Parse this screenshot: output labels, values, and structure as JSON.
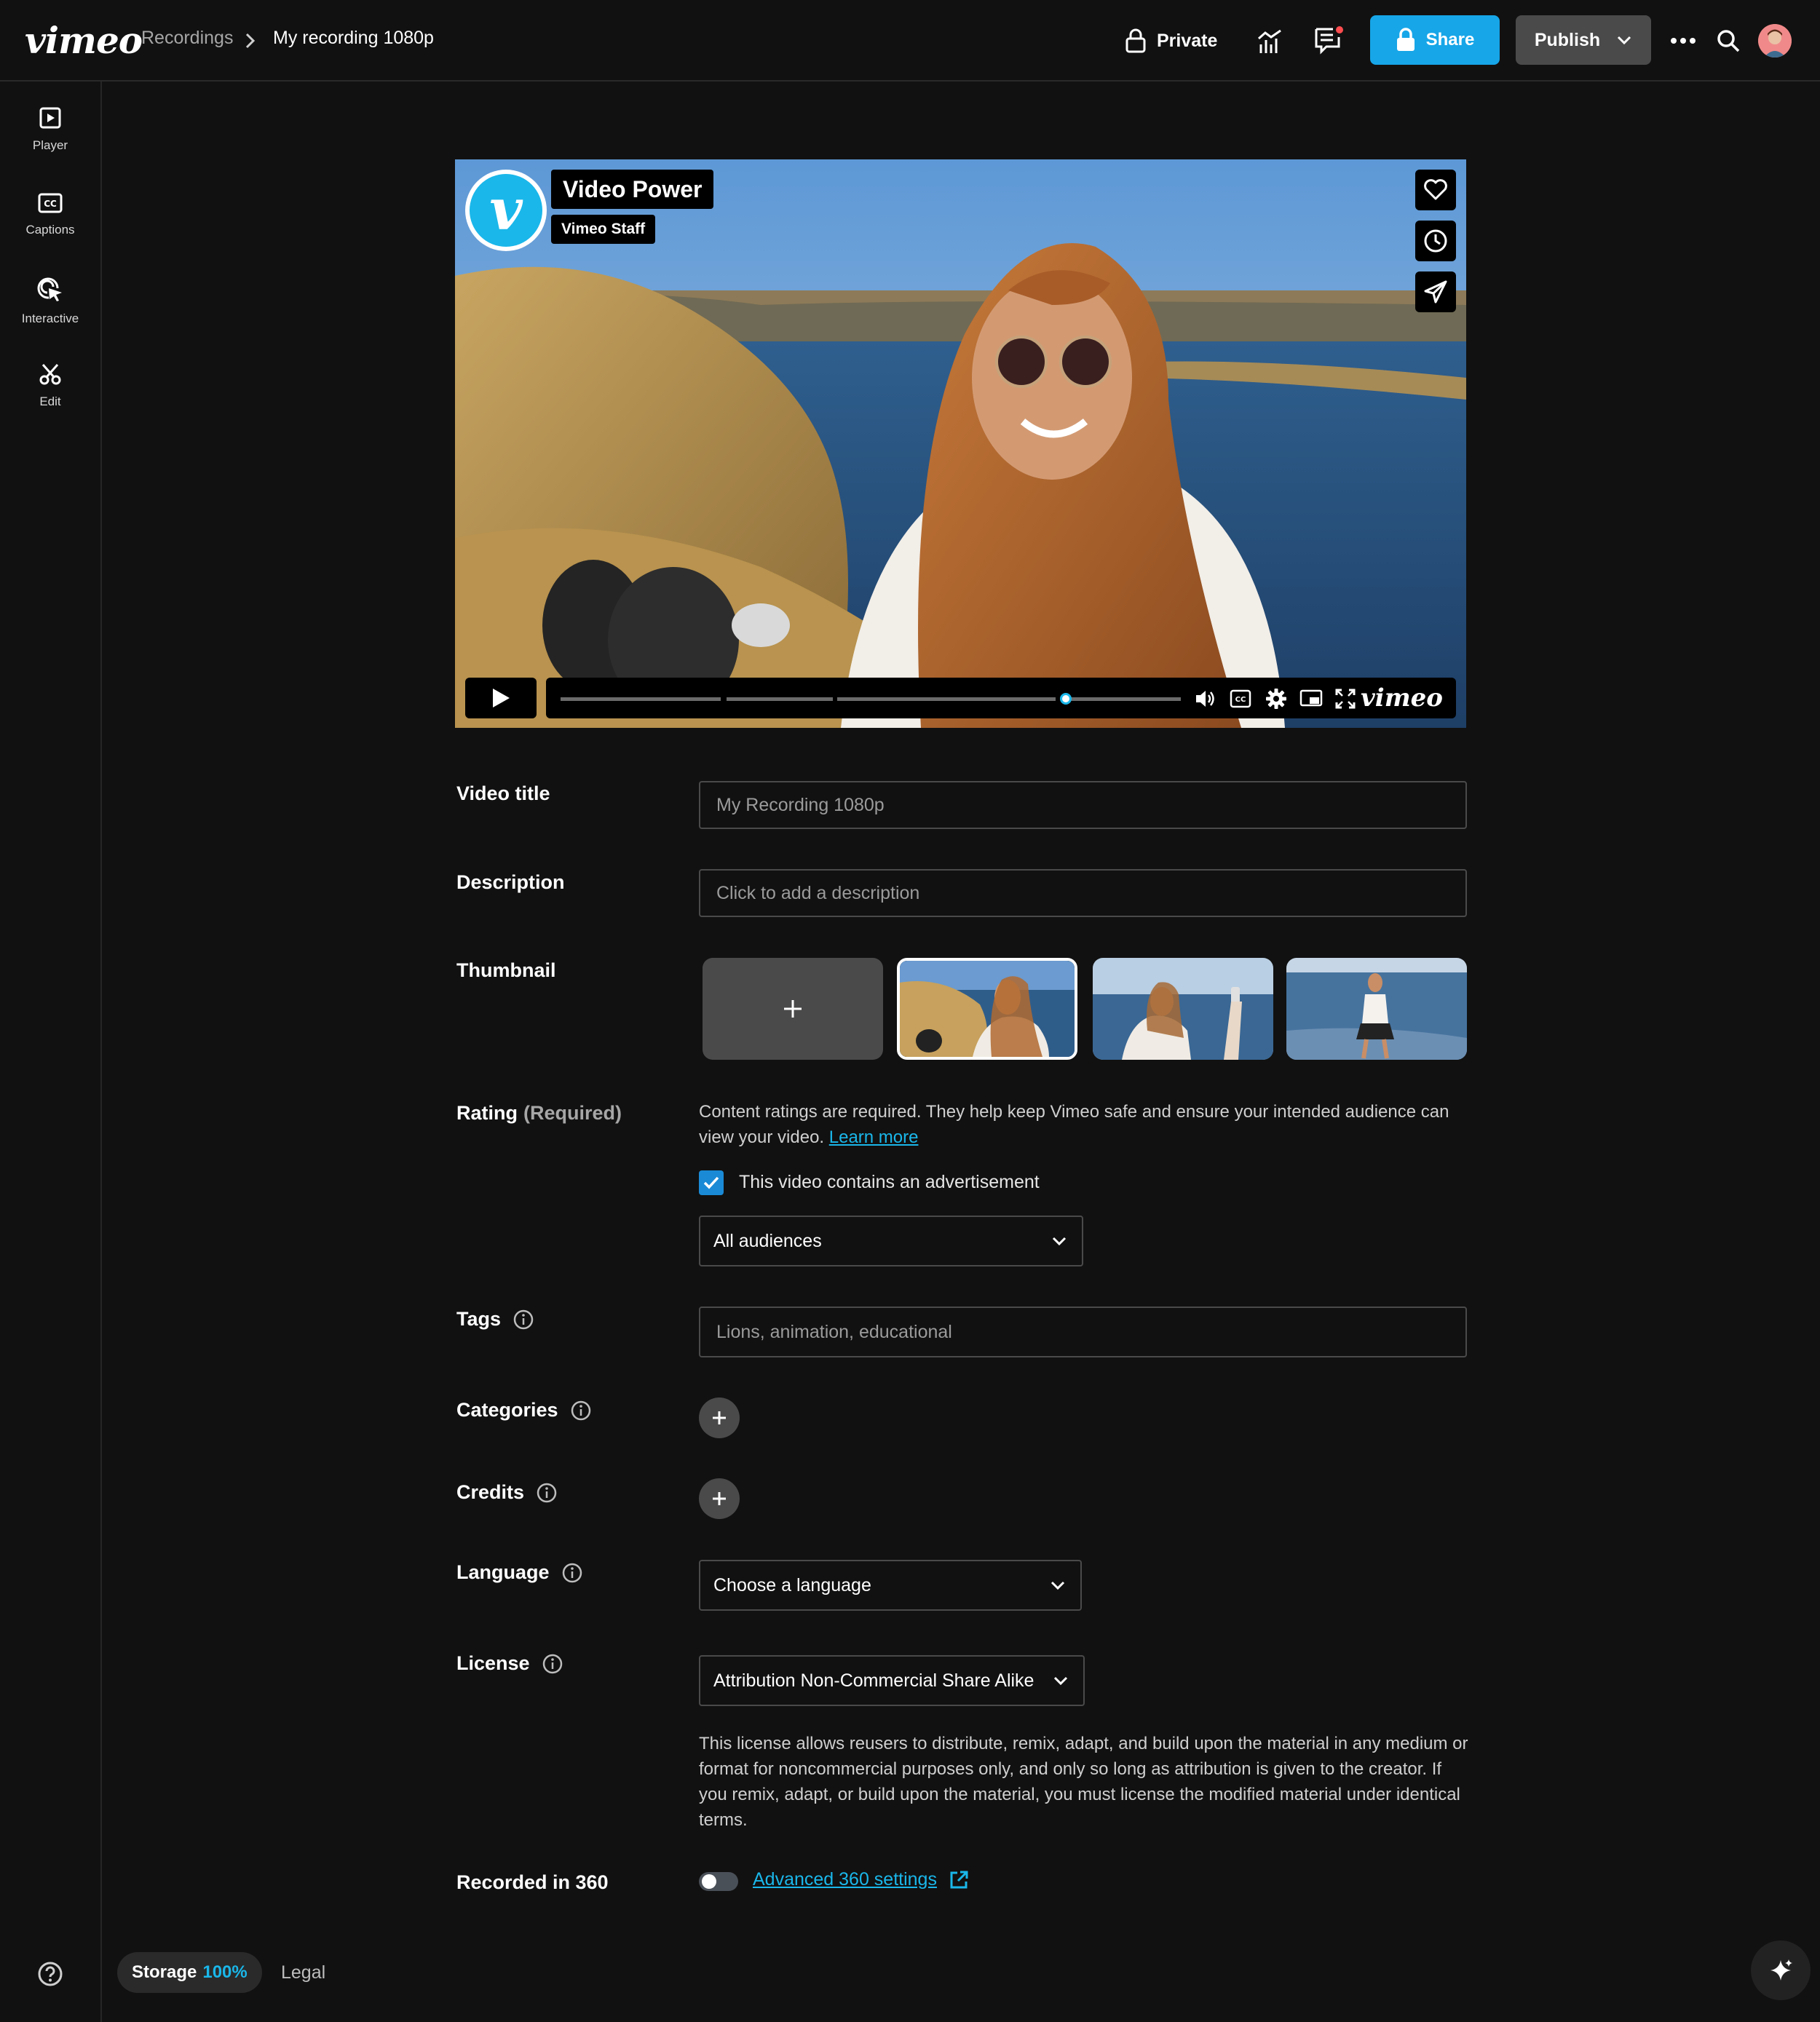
{
  "header": {
    "logo": "vimeo",
    "breadcrumb": {
      "parent": "Recordings",
      "current": "My recording 1080p"
    },
    "privacy_label": "Private",
    "share_label": "Share",
    "publish_label": "Publish"
  },
  "sidebar": {
    "items": [
      {
        "label": "Player",
        "icon": "player-icon"
      },
      {
        "label": "Captions",
        "icon": "captions-icon"
      },
      {
        "label": "Interactive",
        "icon": "interactive-icon"
      },
      {
        "label": "Edit",
        "icon": "scissors-icon"
      }
    ]
  },
  "player": {
    "channel_name": "Video Power",
    "channel_badge": "Vimeo Staff",
    "channel_logo_letter": "v",
    "brand": "vimeo",
    "cc_label": "CC"
  },
  "form": {
    "video_title": {
      "label": "Video title",
      "value": "My Recording 1080p"
    },
    "description": {
      "label": "Description",
      "placeholder": "Click to add a description"
    },
    "thumbnail": {
      "label": "Thumbnail"
    },
    "rating": {
      "label": "Rating",
      "label_suffix": "(Required)",
      "text": "Content ratings are required. They help keep Vimeo safe and ensure your intended audience can view your video.",
      "learn_more": "Learn more",
      "ad_checkbox_label": "This video contains an advertisement",
      "ad_checked": true,
      "audience": "All audiences"
    },
    "tags": {
      "label": "Tags",
      "placeholder": "Lions, animation, educational"
    },
    "categories": {
      "label": "Categories"
    },
    "credits": {
      "label": "Credits"
    },
    "language": {
      "label": "Language",
      "value": "Choose a language"
    },
    "license": {
      "label": "License",
      "value": "Attribution Non-Commercial Share Alike",
      "description": "This license allows reusers to distribute, remix, adapt, and build upon the material in any medium or format for noncommercial purposes only, and only so long as attribution is given to the creator. If you remix, adapt, or build upon the material, you must license the modified material under identical terms."
    },
    "recorded_360": {
      "label": "Recorded in 360",
      "enabled": false,
      "link": "Advanced 360 settings"
    }
  },
  "footer": {
    "storage_label": "Storage",
    "storage_value": "100%",
    "legal": "Legal"
  },
  "colors": {
    "accent": "#17a6e8",
    "background": "#111111",
    "button_secondary": "#4a4a4a"
  }
}
